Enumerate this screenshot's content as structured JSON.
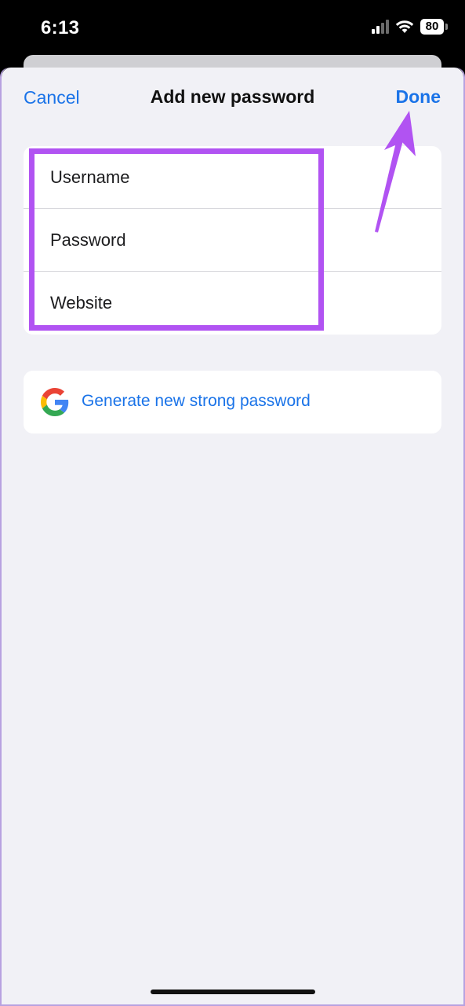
{
  "status_bar": {
    "time": "6:13",
    "battery_percent": "80",
    "icons": [
      "cellular-signal-icon",
      "wifi-icon",
      "battery-icon"
    ]
  },
  "nav": {
    "cancel_label": "Cancel",
    "title": "Add new password",
    "done_label": "Done"
  },
  "form": {
    "fields": [
      {
        "placeholder": "Username",
        "value": ""
      },
      {
        "placeholder": "Password",
        "value": ""
      },
      {
        "placeholder": "Website",
        "value": ""
      }
    ]
  },
  "generate": {
    "label": "Generate new strong password",
    "icon": "google-logo-icon"
  },
  "colors": {
    "accent": "#1a73e8",
    "annotation": "#b153f2",
    "sheet_background": "#f1f1f6"
  }
}
